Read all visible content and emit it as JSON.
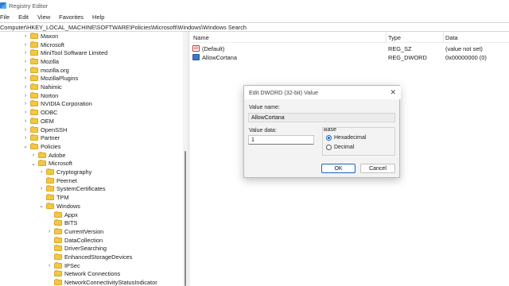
{
  "window": {
    "title": "Registry Editor"
  },
  "menu": [
    "File",
    "Edit",
    "View",
    "Favorites",
    "Help"
  ],
  "address": "Computer\\HKEY_LOCAL_MACHINE\\SOFTWARE\\Policies\\Microsoft\\Windows\\Windows Search",
  "tree": [
    {
      "label": "Maxon",
      "depth": 2,
      "caret": "closed"
    },
    {
      "label": "Microsoft",
      "depth": 2,
      "caret": "closed"
    },
    {
      "label": "MiniTool Software Limited",
      "depth": 2,
      "caret": "closed"
    },
    {
      "label": "Mozilla",
      "depth": 2,
      "caret": "closed"
    },
    {
      "label": "mozilla.org",
      "depth": 2,
      "caret": "closed"
    },
    {
      "label": "MozillaPlugins",
      "depth": 2,
      "caret": "closed"
    },
    {
      "label": "Nahimic",
      "depth": 2,
      "caret": "closed"
    },
    {
      "label": "Norton",
      "depth": 2,
      "caret": "closed"
    },
    {
      "label": "NVIDIA Corporation",
      "depth": 2,
      "caret": "closed"
    },
    {
      "label": "ODBC",
      "depth": 2,
      "caret": "closed"
    },
    {
      "label": "OEM",
      "depth": 2,
      "caret": "closed"
    },
    {
      "label": "OpenSSH",
      "depth": 2,
      "caret": "closed"
    },
    {
      "label": "Partner",
      "depth": 2,
      "caret": "closed"
    },
    {
      "label": "Policies",
      "depth": 2,
      "caret": "open"
    },
    {
      "label": "Adobe",
      "depth": 3,
      "caret": "closed"
    },
    {
      "label": "Microsoft",
      "depth": 3,
      "caret": "open"
    },
    {
      "label": "Cryptography",
      "depth": 4,
      "caret": "closed"
    },
    {
      "label": "Peernet",
      "depth": 4,
      "caret": "none"
    },
    {
      "label": "SystemCertificates",
      "depth": 4,
      "caret": "closed"
    },
    {
      "label": "TPM",
      "depth": 4,
      "caret": "none"
    },
    {
      "label": "Windows",
      "depth": 4,
      "caret": "open"
    },
    {
      "label": "Appx",
      "depth": 5,
      "caret": "none"
    },
    {
      "label": "BITS",
      "depth": 5,
      "caret": "none"
    },
    {
      "label": "CurrentVersion",
      "depth": 5,
      "caret": "closed"
    },
    {
      "label": "DataCollection",
      "depth": 5,
      "caret": "none"
    },
    {
      "label": "DriverSearching",
      "depth": 5,
      "caret": "none"
    },
    {
      "label": "EnhancedStorageDevices",
      "depth": 5,
      "caret": "none"
    },
    {
      "label": "IPSec",
      "depth": 5,
      "caret": "closed"
    },
    {
      "label": "Network Connections",
      "depth": 5,
      "caret": "none"
    },
    {
      "label": "NetworkConnectivityStatusIndicator",
      "depth": 5,
      "caret": "none"
    }
  ],
  "list": {
    "headers": {
      "name": "Name",
      "type": "Type",
      "data": "Data"
    },
    "rows": [
      {
        "name": "(Default)",
        "type": "REG_SZ",
        "data": "(value not set)",
        "icon": "string-value-icon"
      },
      {
        "name": "AllowCortana",
        "type": "REG_DWORD",
        "data": "0x00000000 (0)",
        "icon": "dword-value-icon"
      }
    ]
  },
  "dialog": {
    "title": "Edit DWORD (32-bit) Value",
    "value_name_label": "Value name:",
    "value_name": "AllowCortana",
    "value_data_label": "Value data:",
    "value_data": "1",
    "base_label": "Base",
    "hex_label": "Hexadecimal",
    "dec_label": "Decimal",
    "base_selected": "Hexadecimal",
    "ok_label": "OK",
    "cancel_label": "Cancel",
    "close_glyph": "✕"
  }
}
